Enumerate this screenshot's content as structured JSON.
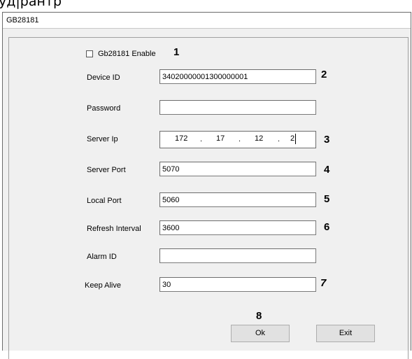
{
  "window": {
    "cropped_title": "уд|рантр",
    "dialog_title": "GB28181"
  },
  "form": {
    "enable_label": "Gb28181 Enable",
    "device_id_label": "Device ID",
    "device_id_value": "34020000001300000001",
    "password_label": "Password",
    "password_value": "",
    "server_ip_label": "Server Ip",
    "server_ip": [
      "172",
      "17",
      "12",
      "2"
    ],
    "server_port_label": "Server Port",
    "server_port_value": "5070",
    "local_port_label": "Local Port",
    "local_port_value": "5060",
    "refresh_interval_label": "Refresh Interval",
    "refresh_interval_value": "3600",
    "alarm_id_label": "Alarm ID",
    "alarm_id_value": "",
    "keep_alive_label": "Keep Alive",
    "keep_alive_value": "30"
  },
  "annotations": [
    "1",
    "2",
    "3",
    "4",
    "5",
    "6",
    "7",
    "8"
  ],
  "buttons": {
    "ok_label": "Ok",
    "exit_label": "Exit"
  }
}
